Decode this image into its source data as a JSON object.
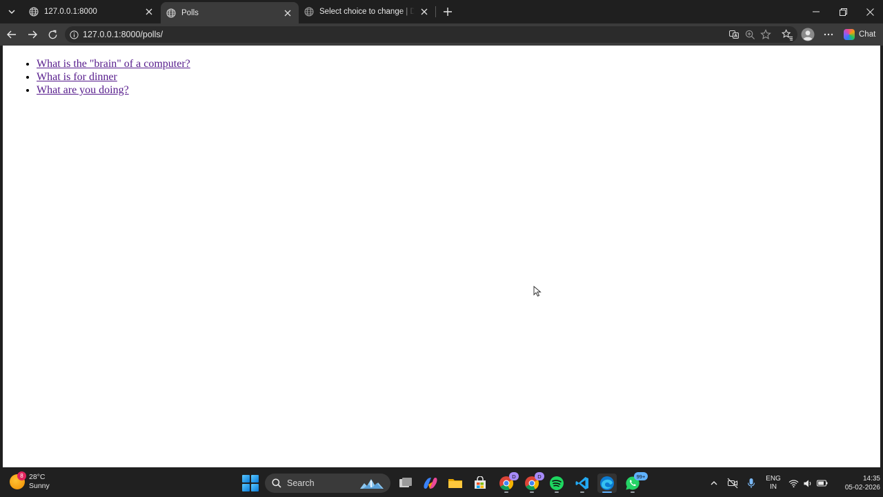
{
  "browser": {
    "tabs": [
      {
        "title": "127.0.0.1:8000",
        "active": false
      },
      {
        "title": "Polls",
        "active": true
      },
      {
        "title": "Select choice to change | Django site admin",
        "active": false
      }
    ],
    "address": "127.0.0.1:8000/polls/",
    "chat_label": "Chat"
  },
  "page": {
    "poll_links": [
      "What is the \"brain\" of a computer?",
      "What is for dinner",
      "What are you doing?"
    ],
    "link_color": "#551a8b"
  },
  "taskbar": {
    "weather": {
      "temp": "28°C",
      "condition": "Sunny",
      "badge": "8"
    },
    "search_label": "Search",
    "chrome_badge": "D",
    "chrome2_badge": "D",
    "whatsapp_badge": "99+",
    "lang_line1": "ENG",
    "lang_line2": "IN",
    "time": "14:35",
    "date": "05-02-2026"
  },
  "colors": {
    "accent": "#5fb2ff",
    "tab_active": "#3b3b3b",
    "frame": "#1f1f1f"
  }
}
